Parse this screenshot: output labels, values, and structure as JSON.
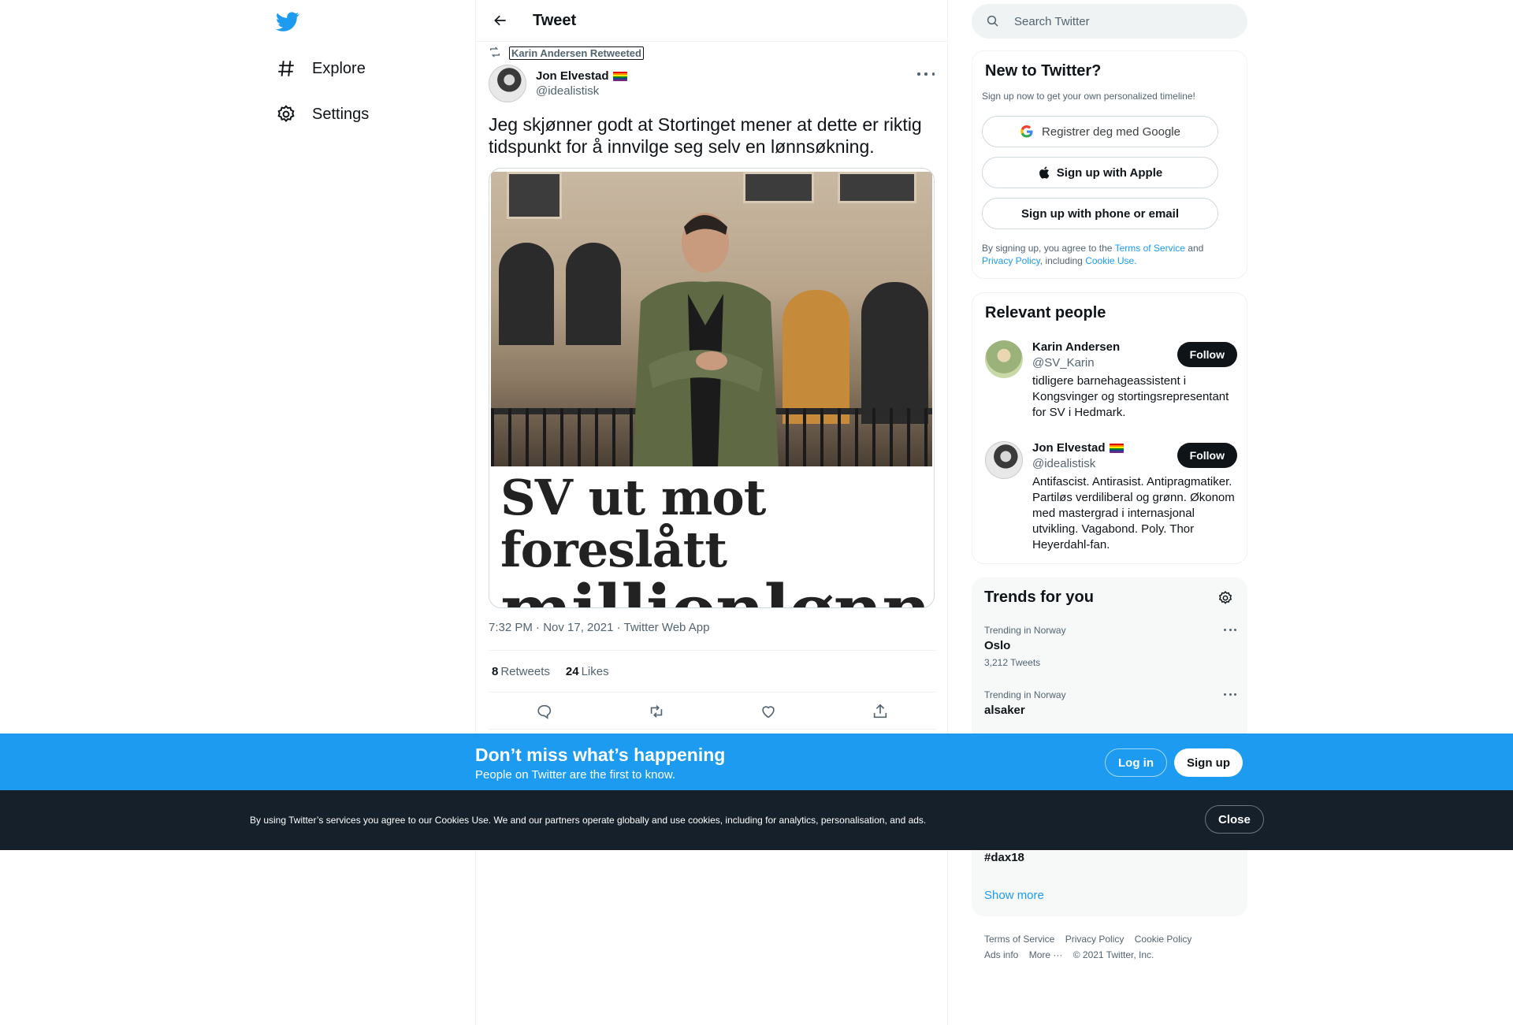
{
  "nav": {
    "items": [
      {
        "label": "Explore",
        "icon": "hashtag-icon"
      },
      {
        "label": "Settings",
        "icon": "gear-icon"
      }
    ]
  },
  "header": {
    "title": "Tweet"
  },
  "tweet": {
    "retweeted_by": "Karin Andersen Retweeted",
    "author_name": "Jon Elvestad",
    "author_handle": "@idealistisk",
    "text": "Jeg skjønner godt at Stortinget mener at dette er riktig tidspunkt for å innvilge seg selv en lønnsøkning.",
    "image_headline_line1": "SV ut mot foreslått",
    "image_headline_line2": "millionlønn",
    "meta": "7:32 PM · Nov 17, 2021 · Twitter Web App",
    "retweets_count": "8",
    "retweets_label": "Retweets",
    "likes_count": "24",
    "likes_label": "Likes"
  },
  "search": {
    "placeholder": "Search Twitter"
  },
  "new_to_twitter": {
    "title": "New to Twitter?",
    "subtitle": "Sign up now to get your own personalized timeline!",
    "google_label": "Registrer deg med Google",
    "apple_label": "Sign up with Apple",
    "email_label": "Sign up with phone or email",
    "terms_prefix": "By signing up, you agree to the",
    "terms_link": "Terms of Service",
    "terms_and": "and",
    "privacy_link": "Privacy Policy",
    "terms_including": ", including",
    "cookie_link": "Cookie Use."
  },
  "relevant_people": {
    "title": "Relevant people",
    "people": [
      {
        "name": "Karin Andersen",
        "handle": "@SV_Karin",
        "bio": "tidligere barnehageassistent i Kongsvinger og stortingsrepresentant for SV i Hedmark.",
        "follow_label": "Follow"
      },
      {
        "name": "Jon Elvestad",
        "handle": "@idealistisk",
        "bio": "Antifascist. Antirasist. Antipragmatiker. Partiløs verdiliberal og grønn. Økonom med mastergrad i internasjonal utvikling. Vagabond. Poly. Thor Heyerdahl-fan.",
        "follow_label": "Follow"
      }
    ]
  },
  "trends": {
    "title": "Trends for you",
    "items": [
      {
        "meta": "Trending in Norway",
        "name": "Oslo",
        "count": "3,212 Tweets"
      },
      {
        "meta": "Trending in Norway",
        "name": "alsaker",
        "count": ""
      },
      {
        "meta": "",
        "name": "#dax18",
        "count": ""
      }
    ],
    "show_more": "Show more"
  },
  "footer": {
    "links": [
      "Terms of Service",
      "Privacy Policy",
      "Cookie Policy",
      "Ads info",
      "More ···",
      "© 2021 Twitter, Inc."
    ]
  },
  "banner": {
    "title": "Don’t miss what’s happening",
    "subtitle": "People on Twitter are the first to know.",
    "login_label": "Log in",
    "signup_label": "Sign up"
  },
  "cookie": {
    "text": "By using Twitter’s services you agree to our Cookies Use. We and our partners operate globally and use cookies, including for analytics, personalisation, and ads.",
    "close_label": "Close"
  },
  "colors": {
    "accent": "#1d9bf0",
    "text": "#0f1419",
    "muted": "#536471",
    "cookie_bg": "#15202b"
  }
}
